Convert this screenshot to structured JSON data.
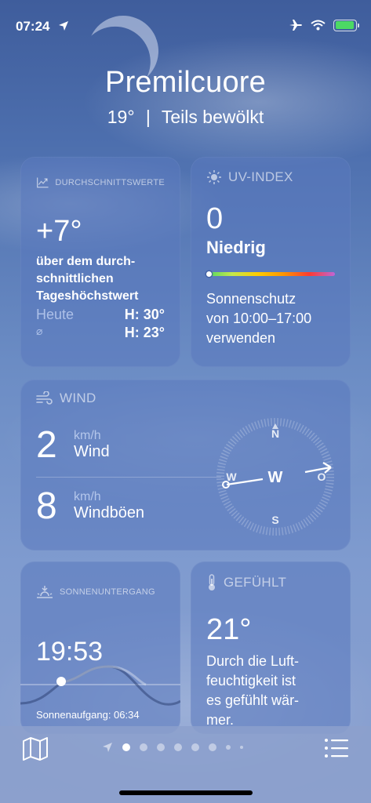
{
  "status_bar": {
    "time": "07:24",
    "icons": [
      "location-arrow-icon",
      "airplane-icon",
      "wifi-icon",
      "battery-charging-icon"
    ],
    "battery_color": "#4cd964"
  },
  "header": {
    "city": "Premilcuore",
    "temperature": "19°",
    "separator": "|",
    "condition": "Teils bewölkt"
  },
  "averages_card": {
    "title": "DURCHSCHNITTSWERTE",
    "icon": "chart-line-icon",
    "value": "+7°",
    "description_lines": [
      "über dem durch-",
      "schnittlichen",
      "Tageshöchstwert"
    ],
    "rows": [
      {
        "label": "Heute",
        "value": "H: 30°"
      },
      {
        "label": "⌀",
        "value": "H: 23°"
      }
    ]
  },
  "uv_card": {
    "title": "UV-INDEX",
    "icon": "sun-icon",
    "value": "0",
    "level": "Niedrig",
    "level_fraction": 0,
    "text_lines": [
      "Sonnenschutz",
      "von 10:00–17:00",
      "verwenden"
    ]
  },
  "wind_card": {
    "title": "WIND",
    "icon": "wind-icon",
    "wind": {
      "value": "2",
      "unit": "km/h",
      "label": "Wind"
    },
    "gusts": {
      "value": "8",
      "unit": "km/h",
      "label": "Windböen"
    },
    "compass": {
      "n": "N",
      "s": "S",
      "o": "O",
      "w_side": "W",
      "center": "W",
      "direction_deg": 280
    }
  },
  "sunset_card": {
    "title": "SONNENUNTERGANG",
    "icon": "sunset-icon",
    "time": "19:53",
    "sunrise": "Sonnenaufgang: 06:34"
  },
  "feels_card": {
    "title": "GEFÜHLT",
    "icon": "thermometer-icon",
    "value": "21°",
    "text_lines": [
      "Durch die Luft-",
      "feuchtigkeit ist",
      "es gefühlt wär-",
      "mer."
    ]
  },
  "bottom_bar": {
    "icons": [
      "map-icon",
      "location-arrow-icon",
      "list-icon"
    ],
    "page_count": 8,
    "active_page": 1
  }
}
